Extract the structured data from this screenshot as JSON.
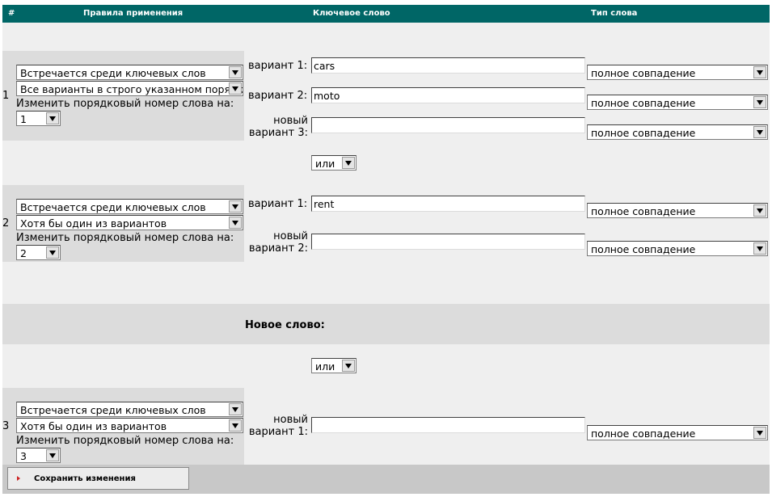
{
  "header": {
    "col_num": "#",
    "col_rules": "Правила применения",
    "col_keyword": "Ключевое слово",
    "col_type": "Тип слова"
  },
  "words": [
    {
      "number": "1",
      "occurrence": "Встречается среди ключевых слов",
      "variant_rule": "Все варианты в строго указанном порядке",
      "reorder_label": "Изменить порядковый номер слова на:",
      "order_value": "1",
      "variants": [
        {
          "label": "вариант 1:",
          "value": "cars",
          "type": "полное совпадение"
        },
        {
          "label": "вариант 2:",
          "value": "moto",
          "type": "полное совпадение"
        },
        {
          "label_line1": "новый",
          "label_line2": "вариант 3:",
          "value": "",
          "type": "полное совпадение"
        }
      ]
    },
    {
      "number": "2",
      "occurrence": "Встречается среди ключевых слов",
      "variant_rule": "Хотя бы один из вариантов",
      "reorder_label": "Изменить порядковый номер слова на:",
      "order_value": "2",
      "variants": [
        {
          "label": "вариант 1:",
          "value": "rent",
          "type": "полное совпадение"
        },
        {
          "label_line1": "новый",
          "label_line2": "вариант 2:",
          "value": "",
          "type": "полное совпадение"
        }
      ]
    },
    {
      "number": "3",
      "occurrence": "Встречается среди ключевых слов",
      "variant_rule": "Хотя бы один из вариантов",
      "reorder_label": "Изменить порядковый номер слова на:",
      "order_value": "3",
      "variants": [
        {
          "label_line1": "новый",
          "label_line2": "вариант 1:",
          "value": "",
          "type": "полное совпадение"
        }
      ]
    }
  ],
  "connectors": [
    "или",
    "или"
  ],
  "new_word_label": "Новое слово:",
  "save_button": "Сохранить изменения",
  "colors": {
    "header_bg": "#006666",
    "panel_bg": "#efefef",
    "rule_bg": "#dcdcdc",
    "footer_bg": "#c8c8c8"
  }
}
